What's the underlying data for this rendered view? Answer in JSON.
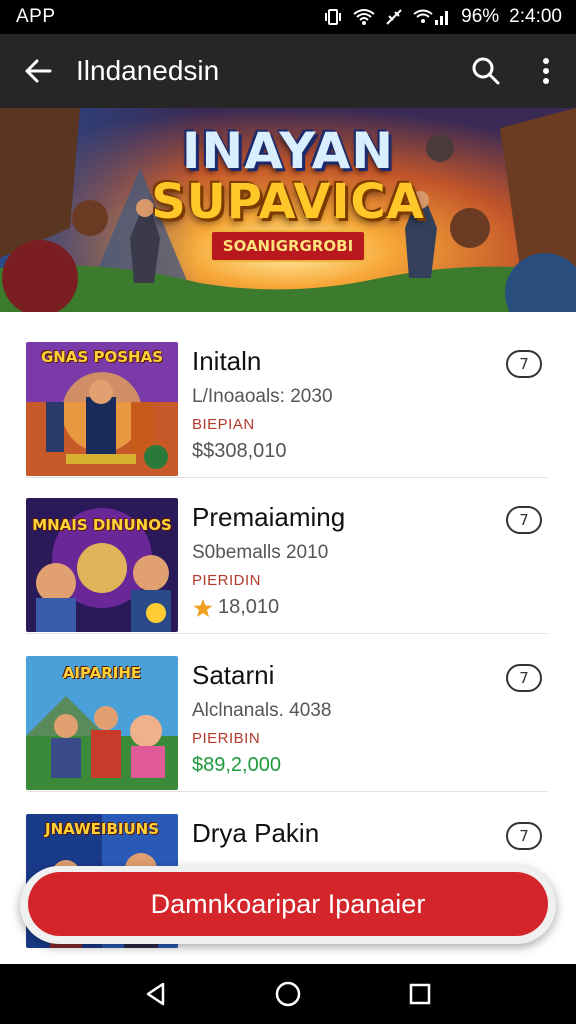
{
  "status_bar": {
    "app": "APP",
    "battery": "96%",
    "time": "2:4:00"
  },
  "app_bar": {
    "title": "Ilndanedsin",
    "icons": [
      "arrow-back-icon",
      "search-icon",
      "more-vert-icon"
    ]
  },
  "banner": {
    "line1": "INAYAN",
    "line2": "SUPAVICA",
    "subtitle": "SOANIGRGROBI"
  },
  "games": [
    {
      "thumb_label": "GNAS POSHAS",
      "name": "Initaln",
      "subtitle": "L/Inoaoals: 2030",
      "tag": "BIEPIAN",
      "price": "$$308,010",
      "price_icon": "",
      "button": "7"
    },
    {
      "thumb_label": "MNAIS DINUNOS",
      "name": "Premaiaming",
      "subtitle": "S0bemalls 2010",
      "tag": "PIERIDIN",
      "price": "18,010",
      "price_icon": "star-icon",
      "button": "7"
    },
    {
      "thumb_label": "AIPARIHE",
      "name": "Satarni",
      "subtitle": "Alclnanals. 4038",
      "tag": "PIERIBIN",
      "price": "$89,2,000",
      "price_icon": "",
      "button": "7"
    },
    {
      "thumb_label": "JNAWEIBIUNS",
      "name": "Drya Pakin",
      "subtitle": "",
      "tag": "",
      "price": "",
      "price_icon": "",
      "button": "7"
    }
  ],
  "cta": {
    "label": "Damnkoaripar Ipanaier"
  },
  "nav_bar": {
    "icons": [
      "back-triangle-icon",
      "home-circle-icon",
      "recents-square-icon"
    ]
  },
  "colors": {
    "status_bar": "#000000",
    "app_bar": "#262626",
    "cta": "#d4262a",
    "price_green": "#1d9a3a",
    "tag_red": "#b23a2a"
  }
}
